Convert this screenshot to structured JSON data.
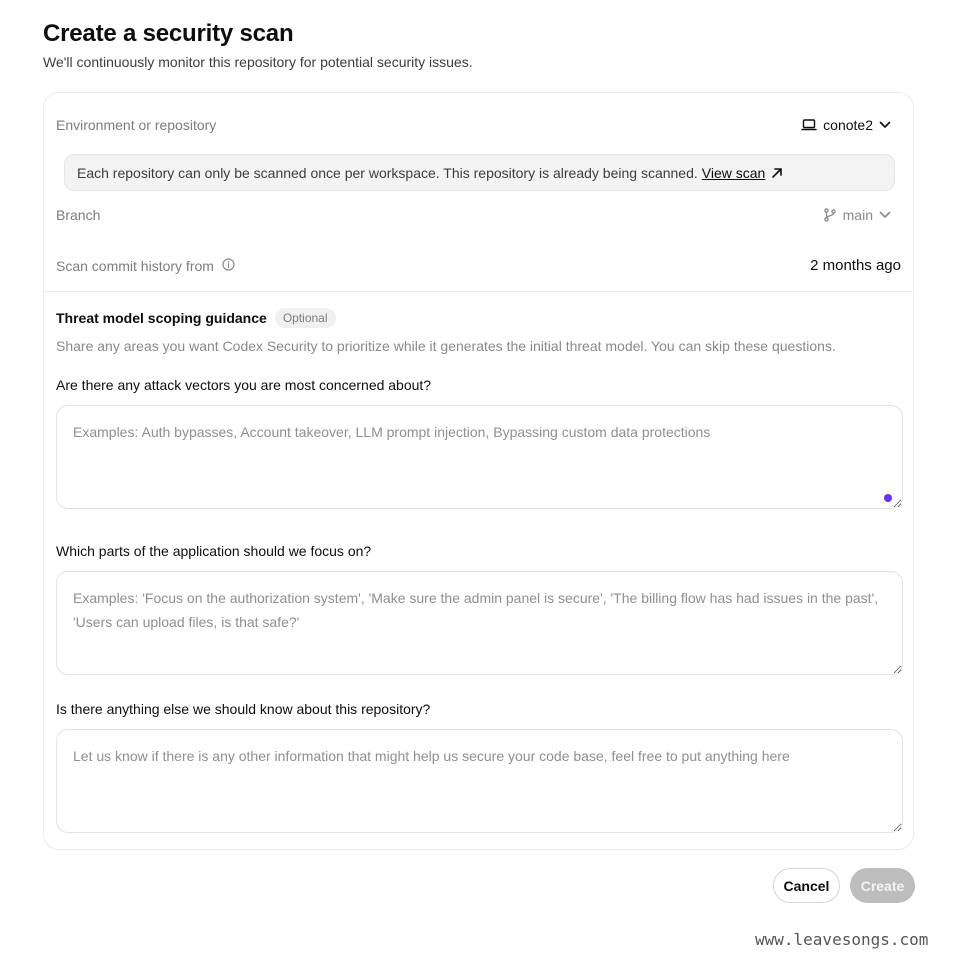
{
  "page": {
    "title": "Create a security scan",
    "subtitle": "We'll continuously monitor this repository for potential security issues."
  },
  "environment": {
    "label": "Environment or repository",
    "value": "conote2",
    "value_icon": "laptop-icon"
  },
  "notice": {
    "text": "Each repository can only be scanned once per workspace. This repository is already being scanned.",
    "link_label": "View scan",
    "link_icon": "external-arrow-icon"
  },
  "branch": {
    "label": "Branch",
    "value": "main",
    "value_icon": "git-branch-icon"
  },
  "history": {
    "label": "Scan commit history from",
    "value": "2 months ago"
  },
  "guidance": {
    "title": "Threat model scoping guidance",
    "badge": "Optional",
    "description": "Share any areas you want Codex Security to prioritize while it generates the initial threat model. You can skip these questions."
  },
  "questions": [
    {
      "label": "Are there any attack vectors you are most concerned about?",
      "placeholder": "Examples: Auth bypasses, Account takeover, LLM prompt injection, Bypassing custom data protections",
      "value": ""
    },
    {
      "label": "Which parts of the application should we focus on?",
      "placeholder": "Examples: 'Focus on the authorization system', 'Make sure the admin panel is secure', 'The billing flow has had issues in the past', 'Users can upload files, is that safe?'",
      "value": ""
    },
    {
      "label": "Is there anything else we should know about this repository?",
      "placeholder": "Let us know if there is any other information that might help us secure your code base, feel free to put anything here",
      "value": ""
    }
  ],
  "actions": {
    "cancel_label": "Cancel",
    "create_label": "Create"
  },
  "watermark": "www.leavesongs.com",
  "colors": {
    "accent_dot": "#6a32f5",
    "disabled_button": "#bdbdbd"
  }
}
